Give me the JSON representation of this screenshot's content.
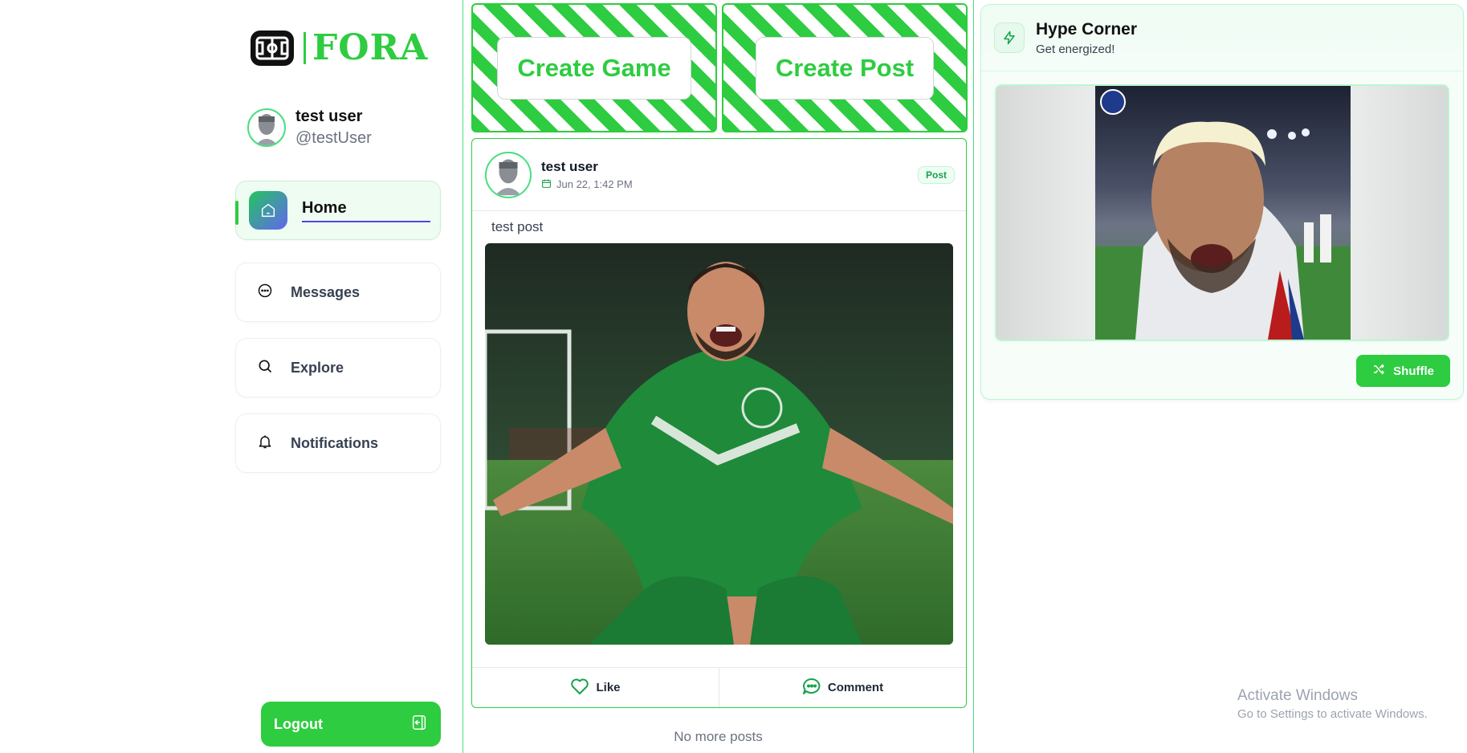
{
  "brand": {
    "name": "FORA",
    "logo_icon": "soccer-field-icon",
    "accent": "#2ecc40"
  },
  "user": {
    "name": "test user",
    "handle": "@testUser"
  },
  "nav": {
    "items": [
      {
        "label": "Home",
        "icon": "home-icon",
        "active": true
      },
      {
        "label": "Messages",
        "icon": "message-icon",
        "active": false
      },
      {
        "label": "Explore",
        "icon": "search-icon",
        "active": false
      },
      {
        "label": "Notifications",
        "icon": "bell-icon",
        "active": false
      }
    ],
    "logout_label": "Logout"
  },
  "actions": {
    "create_game": "Create Game",
    "create_post": "Create Post"
  },
  "post": {
    "author": "test user",
    "date": "Jun 22, 1:42 PM",
    "badge": "Post",
    "text": "test post",
    "like_label": "Like",
    "comment_label": "Comment"
  },
  "feed": {
    "end_text": "No more posts"
  },
  "hype": {
    "title": "Hype Corner",
    "subtitle": "Get energized!",
    "shuffle_label": "Shuffle"
  },
  "system": {
    "activate_title": "Activate Windows",
    "activate_sub": "Go to Settings to activate Windows."
  }
}
